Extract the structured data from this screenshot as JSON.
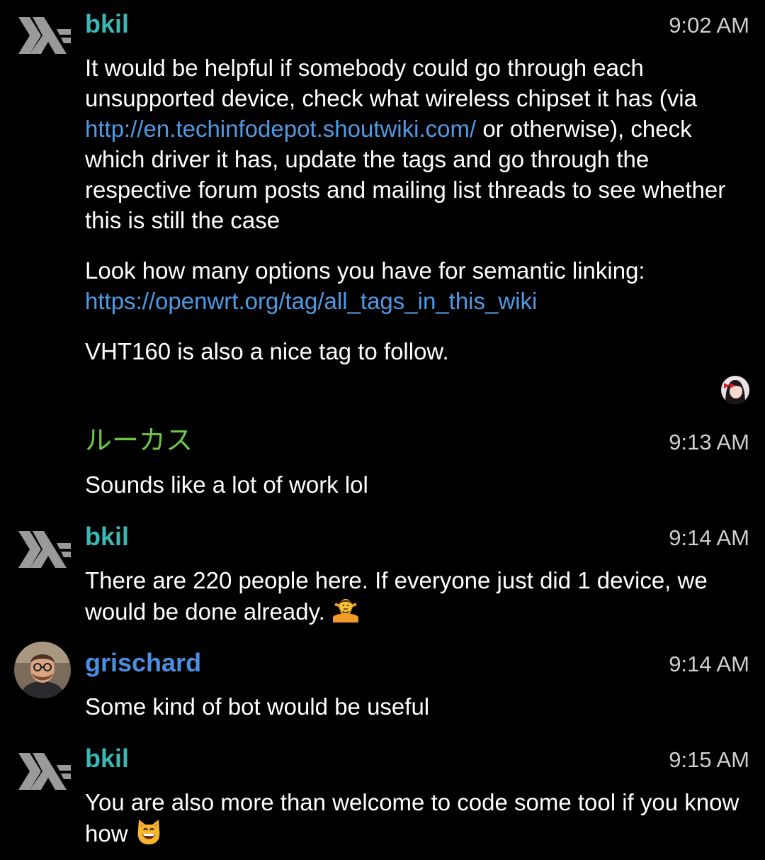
{
  "colors": {
    "background": "#000000",
    "bkil_name": "#3bb7b4",
    "lucas_name": "#6cc548",
    "grischard_name": "#4a8fe0",
    "link": "#4e9be6",
    "timestamp": "#cfcfcf"
  },
  "messages": [
    {
      "sender": "bkil",
      "avatar_icon": "haskell-logo-icon",
      "time": "9:02 AM",
      "p1_a": "It would be helpful if somebody could go through each unsupported device, check what wireless chipset it has (via ",
      "p1_link": "http://en.techinfodepot.shoutwiki.com/",
      "p1_b": " or otherwise), check which driver it has, update the tags and go through the respective forum posts and mailing list threads to see whether this is still the case",
      "p2_a": "Look how many options you have for semantic linking: ",
      "p2_link": "https://openwrt.org/tag/all_tags_in_this_wiki",
      "p3": "VHT160 is also a nice tag to follow."
    },
    {
      "sender": "ルーカス",
      "time": "9:13 AM",
      "text": "Sounds like a lot of work lol"
    },
    {
      "sender": "bkil",
      "avatar_icon": "haskell-logo-icon",
      "time": "9:14 AM",
      "text": "There are 220 people here. If everyone just did 1 device, we would be done already. ",
      "emoji": "person-shrugging-emoji"
    },
    {
      "sender": "grischard",
      "avatar_icon": "user-photo-avatar",
      "time": "9:14 AM",
      "text": "Some kind of bot would be useful"
    },
    {
      "sender": "bkil",
      "avatar_icon": "haskell-logo-icon",
      "time": "9:15 AM",
      "text": "You are also more than welcome to code some tool if you know how ",
      "emoji": "grinning-cat-emoji"
    }
  ],
  "read_receipt_icon": "anime-avatar-read-receipt-icon"
}
